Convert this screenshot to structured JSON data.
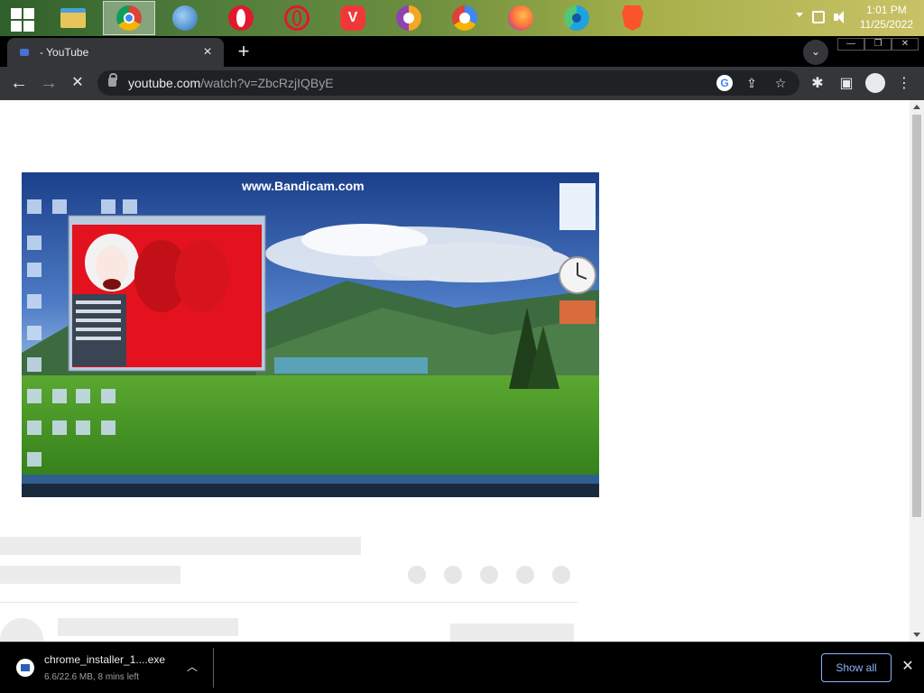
{
  "taskbar": {
    "apps": [
      {
        "name": "file-explorer-icon",
        "color": "#e8c55a"
      },
      {
        "name": "chrome-icon",
        "color": "#4285f4",
        "active": true
      },
      {
        "name": "internet-explorer-icon",
        "color": "#3a78c6"
      },
      {
        "name": "opera-icon",
        "color": "#e0192d"
      },
      {
        "name": "opera-gx-icon",
        "color": "#e0192d"
      },
      {
        "name": "vivaldi-icon",
        "color": "#ef3939"
      },
      {
        "name": "yandex-browser-icon",
        "color": "#f5a623"
      },
      {
        "name": "chromium-variant-icon",
        "color": "#4285f4"
      },
      {
        "name": "firefox-icon",
        "color": "#ff7139"
      },
      {
        "name": "edge-icon",
        "color": "#1fa2e0"
      },
      {
        "name": "brave-icon",
        "color": "#fb542b"
      }
    ],
    "clock_time": "1:01 PM",
    "clock_date": "11/25/2022"
  },
  "browser": {
    "tab_title": "- YouTube",
    "tab_close": "×",
    "new_tab": "+",
    "url_host": "youtube.com",
    "url_path": "/watch?v=ZbcRzjIQByE",
    "back": "←",
    "forward": "→",
    "stop": "✕"
  },
  "download": {
    "filename": "chrome_installer_1....exe",
    "status": "6.6/22.6 MB, 8 mins left",
    "show_all": "Show all",
    "close": "✕"
  },
  "video": {
    "watermark": "www.Bandicam.com"
  },
  "colors": {
    "toolbar": "#35363a",
    "omnibox": "#202124",
    "link_blue": "#8ab4f8"
  }
}
